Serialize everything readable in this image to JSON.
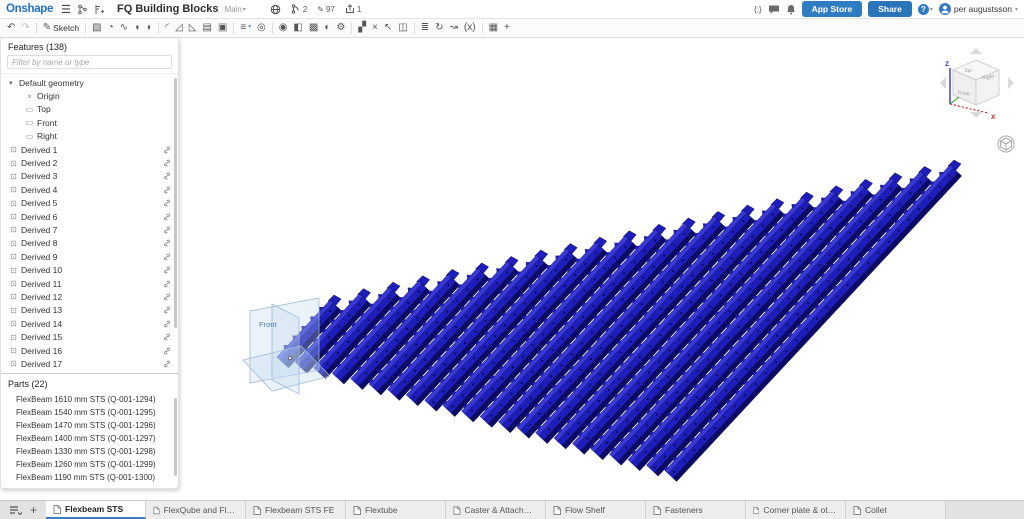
{
  "topbar": {
    "logo": "Onshape",
    "document_title": "FQ Building Blocks",
    "workspace": "Main",
    "counts": {
      "versions": "2",
      "changes": "97",
      "exports": "1"
    },
    "buttons": {
      "app_store": "App Store",
      "share": "Share"
    },
    "help_glyph": "?",
    "featurescript_glyph": "{;}",
    "user": "per augustsson"
  },
  "toolbar": {
    "items": [
      {
        "name": "undo-icon",
        "glyph": "↶"
      },
      {
        "name": "redo-icon",
        "glyph": "↷",
        "muted": true
      },
      {
        "divider": true
      },
      {
        "name": "sketch-button",
        "glyph": "✎",
        "label": "Sketch"
      },
      {
        "divider": true
      },
      {
        "name": "extrude-icon",
        "glyph": "▧"
      },
      {
        "name": "revolve-icon",
        "glyph": "◔"
      },
      {
        "name": "sweep-icon",
        "glyph": "∿"
      },
      {
        "name": "loft-icon",
        "glyph": "◖"
      },
      {
        "name": "thicken-icon",
        "glyph": "◗"
      },
      {
        "divider": true
      },
      {
        "name": "fillet-icon",
        "glyph": "◜"
      },
      {
        "name": "chamfer-icon",
        "glyph": "◿"
      },
      {
        "name": "draft-icon",
        "glyph": "◺"
      },
      {
        "name": "rib-icon",
        "glyph": "▤"
      },
      {
        "name": "shell-icon",
        "glyph": "▣"
      },
      {
        "divider": true
      },
      {
        "name": "boolean-icon",
        "glyph": "≡",
        "caret": "▾"
      },
      {
        "name": "hole-icon",
        "glyph": "◎"
      },
      {
        "divider": true
      },
      {
        "name": "visibility-icon",
        "glyph": "◉"
      },
      {
        "name": "section-view-icon",
        "glyph": "◧"
      },
      {
        "name": "named-views-icon",
        "glyph": "▩"
      },
      {
        "name": "appearance-icon",
        "glyph": "◐"
      },
      {
        "name": "part-settings-icon",
        "glyph": "⚙"
      },
      {
        "divider": true
      },
      {
        "name": "mirror-icon",
        "glyph": "▞"
      },
      {
        "name": "delete-part-icon",
        "glyph": "×"
      },
      {
        "name": "transform-icon",
        "glyph": "↖"
      },
      {
        "name": "split-icon",
        "glyph": "◫"
      },
      {
        "divider": true
      },
      {
        "name": "linear-pattern-icon",
        "glyph": "≣"
      },
      {
        "name": "circular-pattern-icon",
        "glyph": "↻"
      },
      {
        "name": "curve-pattern-icon",
        "glyph": "↝"
      },
      {
        "name": "variables-icon",
        "glyph": "(x)"
      },
      {
        "divider": true
      },
      {
        "name": "measure-icon",
        "glyph": "▦"
      },
      {
        "name": "add-custom-feature-icon",
        "glyph": "+"
      }
    ]
  },
  "features_panel": {
    "header": "Features (138)",
    "filter_placeholder": "Filter by name or type",
    "default_geometry": {
      "label": "Default geometry",
      "children": [
        {
          "label": "Origin",
          "icon": "×"
        },
        {
          "label": "Top",
          "icon": "▭"
        },
        {
          "label": "Front",
          "icon": "▭"
        },
        {
          "label": "Right",
          "icon": "▭"
        }
      ]
    },
    "derived": [
      "Derived 1",
      "Derived 2",
      "Derived 3",
      "Derived 4",
      "Derived 5",
      "Derived 6",
      "Derived 7",
      "Derived 8",
      "Derived 9",
      "Derived 10",
      "Derived 11",
      "Derived 12",
      "Derived 13",
      "Derived 14",
      "Derived 15",
      "Derived 16",
      "Derived 17"
    ]
  },
  "parts_panel": {
    "header": "Parts (22)",
    "parts": [
      "FlexBeam 1610 mm STS (Q-001-1294)",
      "FlexBeam 1540 mm STS (Q-001-1295)",
      "FlexBeam 1470 mm STS (Q-001-1296)",
      "FlexBeam 1400 mm STS (Q-001-1297)",
      "FlexBeam 1330 mm STS (Q-001-1298)",
      "FlexBeam 1260 mm STS (Q-001-1299)",
      "FlexBeam 1190 mm STS (Q-001-1300)"
    ]
  },
  "viewport": {
    "plane_label": "Front",
    "view_cube": {
      "top": "Top",
      "front": "Front",
      "right": "Right",
      "z_axis": "Z",
      "x_axis": "X"
    },
    "model": {
      "beam_count": 22,
      "color_light": "#3838d8",
      "color_mid": "#1e1ebc",
      "color_dark": "#0b0b66",
      "color_outline": "#06063f",
      "plane_stroke": "#9cb9d6",
      "plane_fill": "rgba(190,215,240,0.3)"
    }
  },
  "tabbar": {
    "tabs": [
      {
        "name": "tab-flexbeam-sts",
        "label": "Flexbeam STS",
        "active": true
      },
      {
        "name": "tab-flexqube-and-flexplate",
        "label": "FlexQube and Flexplate"
      },
      {
        "name": "tab-flexbeam-sts-fe",
        "label": "Flexbeam STS FE"
      },
      {
        "name": "tab-flextube",
        "label": "Flextube"
      },
      {
        "name": "tab-caster-attachment",
        "label": "Caster & Attachment"
      },
      {
        "name": "tab-flow-shelf",
        "label": "Flow Shelf"
      },
      {
        "name": "tab-fasteners",
        "label": "Fasteners"
      },
      {
        "name": "tab-corner-plate",
        "label": "Corner plate & other pla.."
      },
      {
        "name": "tab-collet",
        "label": "Collet"
      }
    ]
  }
}
